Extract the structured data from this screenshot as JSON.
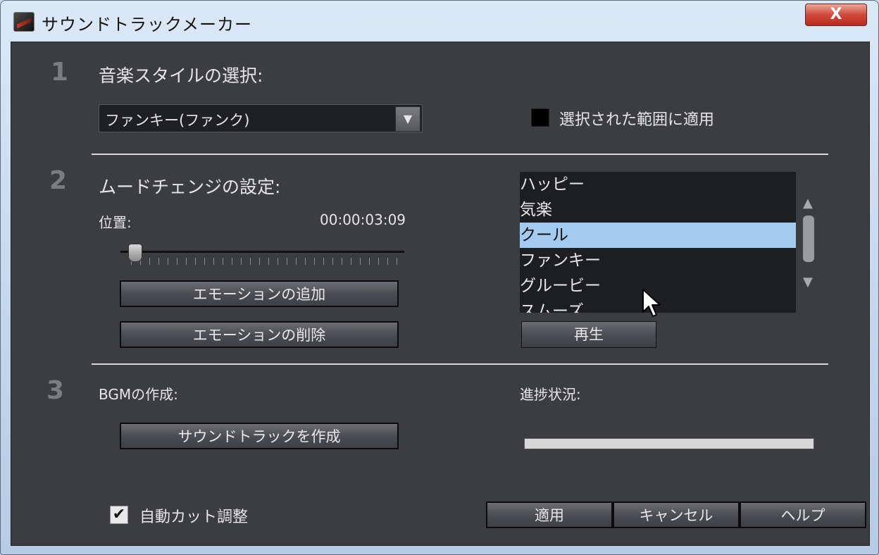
{
  "window": {
    "title": "サウンドトラックメーカー",
    "close_label": "X"
  },
  "step1": {
    "number": "1",
    "heading": "音楽スタイルの選択:",
    "style_dropdown": {
      "selected": "ファンキー(ファンク)"
    },
    "apply_selection_label": "選択された範囲に適用",
    "apply_selection_checked": false
  },
  "step2": {
    "number": "2",
    "heading": "ムードチェンジの設定:",
    "position_label": "位置:",
    "position_time": "00:00:03:09",
    "slider_position": 0.05,
    "add_emotion_label": "エモーションの追加",
    "delete_emotion_label": "エモーションの削除",
    "mood_list": [
      "ハッピー",
      "気楽",
      "クール",
      "ファンキー",
      "グルービー",
      "スムーズ"
    ],
    "mood_selected_index": 2,
    "play_label": "再生"
  },
  "step3": {
    "number": "3",
    "heading": "BGMの作成:",
    "create_label": "サウンドトラックを作成",
    "progress_label": "進捗状況:",
    "progress_value": 1.0
  },
  "footer": {
    "auto_cut_label": "自動カット調整",
    "auto_cut_checked": true,
    "apply_label": "適用",
    "cancel_label": "キャンセル",
    "help_label": "ヘルプ"
  },
  "colors": {
    "panel_bg": "#3b3d41",
    "selection": "#a3cbef",
    "close_red": "#d0493a"
  },
  "icons": {
    "app": "soundtrack-app-icon",
    "dropdown": "triangle-down",
    "scroll_up": "triangle-up",
    "scroll_down": "triangle-down",
    "checkmark": "check"
  }
}
